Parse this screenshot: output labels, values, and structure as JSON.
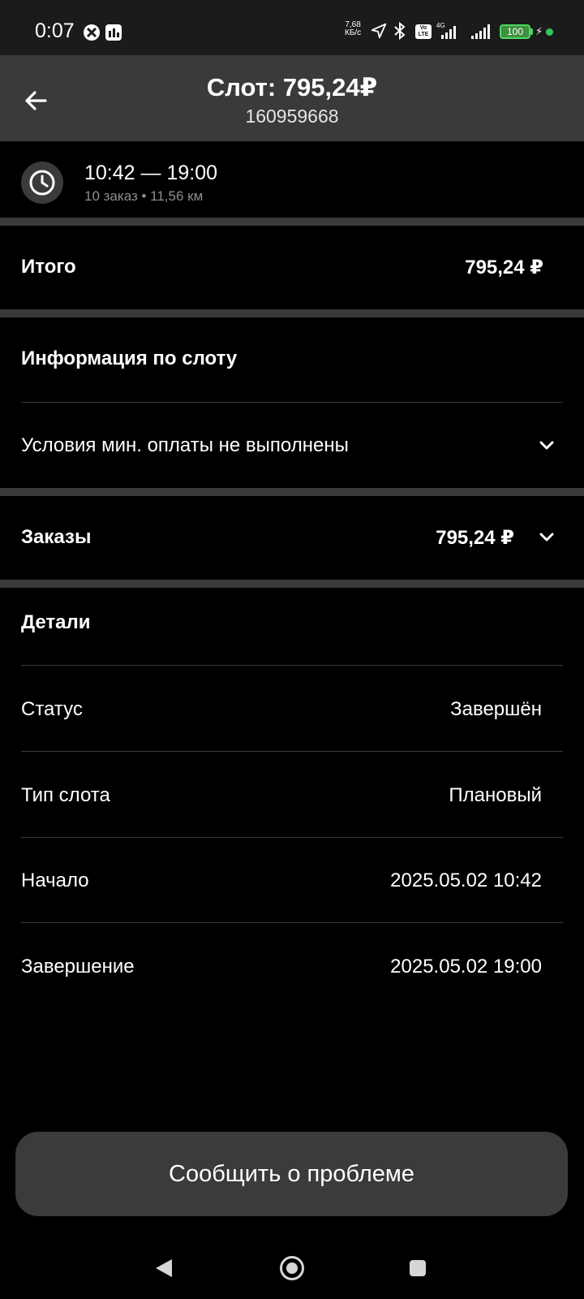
{
  "status_bar": {
    "time": "0:07",
    "net_speed_value": "7,68",
    "net_speed_unit": "КБ/с",
    "network_type": "4G",
    "volte_label": "Vo LTE",
    "battery": "100"
  },
  "header": {
    "title": "Слот: 795,24₽",
    "subtitle": "160959668"
  },
  "time_slot": {
    "range": "10:42 — 19:00",
    "meta": "10 заказ • 11,56 км"
  },
  "total": {
    "label": "Итого",
    "value": "795,24 ₽"
  },
  "slot_info": {
    "title": "Информация по слоту",
    "condition": "Условия мин. оплаты не выполнены"
  },
  "orders": {
    "label": "Заказы",
    "value": "795,24 ₽"
  },
  "details": {
    "title": "Детали",
    "rows": [
      {
        "label": "Статус",
        "value": "Завершён"
      },
      {
        "label": "Тип слота",
        "value": "Плановый"
      },
      {
        "label": "Начало",
        "value": "2025.05.02 10:42"
      },
      {
        "label": "Завершение",
        "value": "2025.05.02 19:00"
      }
    ]
  },
  "report_button": "Сообщить о проблеме"
}
